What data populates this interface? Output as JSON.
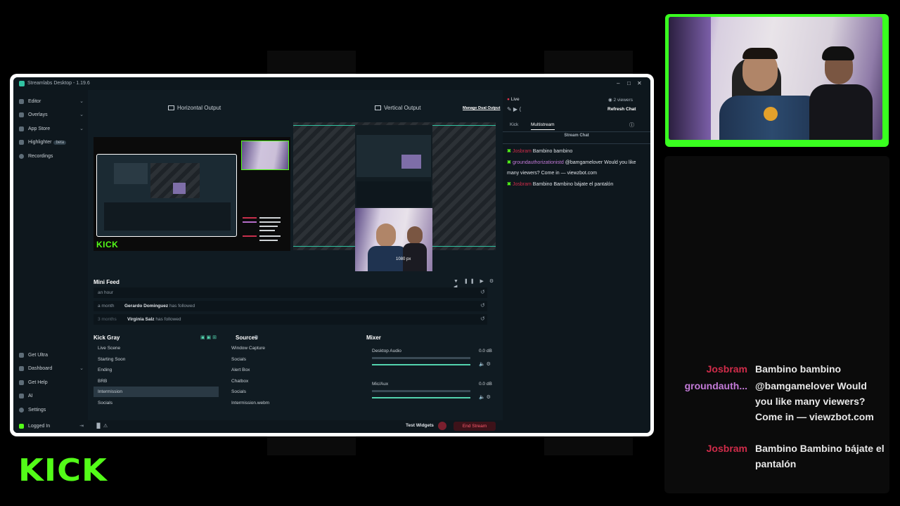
{
  "app": {
    "title": "Streamlabs Desktop - 1.19.6",
    "window_controls": [
      "–",
      "□",
      "✕"
    ]
  },
  "sidebar": {
    "top_items": [
      {
        "label": "Editor",
        "icon": "editor-icon",
        "chevron": "⌄"
      },
      {
        "label": "Overlays",
        "icon": "overlays-icon",
        "chevron": "⌄"
      },
      {
        "label": "App Store",
        "icon": "store-icon",
        "chevron": "⌄"
      },
      {
        "label": "Highlighter",
        "icon": "highlighter-icon",
        "badge": "beta"
      },
      {
        "label": "Recordings",
        "icon": "recordings-icon"
      }
    ],
    "bottom_items": [
      {
        "label": "Get Ultra",
        "icon": "ultra-icon"
      },
      {
        "label": "Dashboard",
        "icon": "dashboard-icon",
        "chevron": "⌄"
      },
      {
        "label": "Get Help",
        "icon": "help-icon"
      },
      {
        "label": "AI",
        "icon": "ai-icon"
      },
      {
        "label": "Settings",
        "icon": "gear-icon"
      },
      {
        "label": "Logged In",
        "icon": "kick-icon"
      }
    ]
  },
  "outputs": {
    "horizontal": "Horizontal Output",
    "vertical": "Vertical Output",
    "manage": "Manage Dual Output",
    "kick_logo": "KICK",
    "resolution_label": "1080 px"
  },
  "mini_feed": {
    "title": "Mini Feed",
    "rows": [
      {
        "time": "an hour",
        "user": "",
        "action": ""
      },
      {
        "time": "a month",
        "user": "Gerardo Dominguez",
        "action": "has followed"
      },
      {
        "time": "3 months",
        "user": "Virginia Salz",
        "action": "has followed"
      }
    ]
  },
  "scenes": {
    "title": "Kick Gray",
    "items": [
      "Live Scene",
      "Starting Soon",
      "Ending",
      "BRB",
      "Intermission",
      "Socials"
    ],
    "selected_index": 4
  },
  "sources": {
    "title": "Sources",
    "items": [
      "Window Capture",
      "Socials",
      "Alert Box",
      "Chatbox",
      "Socials",
      "Intermission.webm"
    ]
  },
  "mixer": {
    "title": "Mixer",
    "channels": [
      {
        "name": "Desktop Audio",
        "db": "0.0 dB",
        "level": 0.06,
        "volume": 1.0
      },
      {
        "name": "Mic/Aux",
        "db": "0.0 dB",
        "level": 0.0,
        "volume": 1.0
      }
    ]
  },
  "footer": {
    "test_widgets": "Test Widgets",
    "end_stream": "End Stream"
  },
  "chat_panel": {
    "live": "Live",
    "viewers": "2 viewers",
    "refresh": "Refresh Chat",
    "tabs": [
      "Kick",
      "Multistream"
    ],
    "active_tab": "Multistream",
    "header": "Stream Chat",
    "messages": [
      {
        "user": "Josbram",
        "text": "Bambino bambino"
      },
      {
        "user": "groundauthorizationistd",
        "text": "@bamgamelover Would you like many viewers? Come in — viewzbot.com"
      },
      {
        "user": "Josbram",
        "text": "Bambino Bambino bájate el pantalón"
      }
    ]
  },
  "overlay_chat": {
    "messages": [
      {
        "user": "Josbram",
        "text": "Bambino bambino"
      },
      {
        "user": "groundauth...",
        "text": "@bamgamelover Would you like many viewers? Come in — viewzbot.com"
      },
      {
        "user": "Josbram",
        "text": "Bambino Bambino bájate el pantalón"
      }
    ]
  },
  "brand": {
    "logo": "KICK",
    "accent": "#53fc18",
    "name_red": "#d12c4a",
    "name_pink": "#c47bd9",
    "end_stream_color": "#e3344b"
  }
}
